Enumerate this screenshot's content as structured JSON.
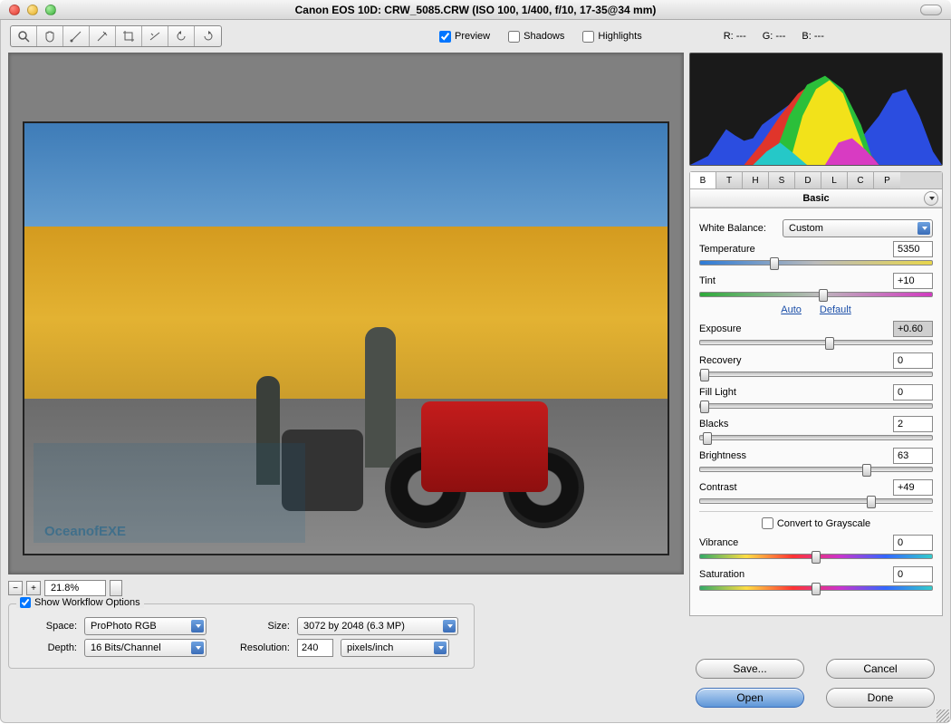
{
  "titlebar": {
    "text": "Canon EOS 10D:  CRW_5085.CRW  (ISO 100, 1/400, f/10, 17-35@34 mm)"
  },
  "toolbar": {
    "preview_label": "Preview",
    "shadows_label": "Shadows",
    "highlights_label": "Highlights",
    "preview_checked": true,
    "shadows_checked": false,
    "highlights_checked": false
  },
  "readout": {
    "r": "R: ---",
    "g": "G: ---",
    "b": "B: ---"
  },
  "zoom": {
    "value": "21.8%"
  },
  "watermark": "OceanofEXE",
  "workflow": {
    "legend": "Show Workflow Options",
    "legend_checked": true,
    "space_label": "Space:",
    "space_value": "ProPhoto RGB",
    "size_label": "Size:",
    "size_value": "3072 by 2048  (6.3 MP)",
    "depth_label": "Depth:",
    "depth_value": "16 Bits/Channel",
    "resolution_label": "Resolution:",
    "resolution_value": "240",
    "resolution_unit": "pixels/inch"
  },
  "tabs": {
    "list": [
      "B",
      "T",
      "H",
      "S",
      "D",
      "L",
      "C",
      "P"
    ],
    "active": 0,
    "title": "Basic"
  },
  "basic": {
    "wb_label": "White Balance:",
    "wb_value": "Custom",
    "temperature_label": "Temperature",
    "temperature_value": "5350",
    "tint_label": "Tint",
    "tint_value": "+10",
    "auto_label": "Auto",
    "default_label": "Default",
    "exposure_label": "Exposure",
    "exposure_value": "+0.60",
    "exposure_hl": true,
    "recovery_label": "Recovery",
    "recovery_value": "0",
    "fill_label": "Fill Light",
    "fill_value": "0",
    "blacks_label": "Blacks",
    "blacks_value": "2",
    "brightness_label": "Brightness",
    "brightness_value": "63",
    "contrast_label": "Contrast",
    "contrast_value": "+49",
    "grayscale_label": "Convert to Grayscale",
    "vibrance_label": "Vibrance",
    "vibrance_value": "0",
    "saturation_label": "Saturation",
    "saturation_value": "0"
  },
  "buttons": {
    "save": "Save...",
    "cancel": "Cancel",
    "open": "Open",
    "done": "Done"
  }
}
